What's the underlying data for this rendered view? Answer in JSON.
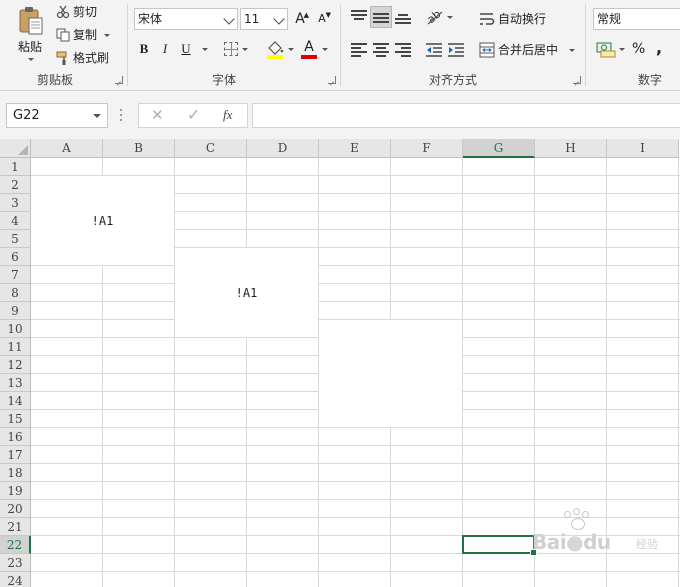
{
  "ribbon": {
    "clipboard": {
      "paste_label": "粘贴",
      "cut_label": "剪切",
      "copy_label": "复制",
      "format_painter_label": "格式刷",
      "group_label": "剪贴板"
    },
    "font": {
      "font_name": "宋体",
      "font_size": "11",
      "bold_label": "B",
      "italic_label": "I",
      "underline_label": "U",
      "increase_label": "A",
      "decrease_label": "A",
      "font_color_label": "A",
      "group_label": "字体",
      "fill_color": "#ffff00",
      "font_color": "#e00000"
    },
    "alignment": {
      "wrap_text_label": "自动换行",
      "merge_center_label": "合并后居中",
      "group_label": "对齐方式"
    },
    "number": {
      "format_value": "常规",
      "percent_label": "%",
      "comma_label": ",",
      "group_label": "数字"
    }
  },
  "formula_bar": {
    "name_box_value": "G22",
    "cancel_icon": "✕",
    "enter_icon": "✓",
    "fx_label": "fx",
    "formula_value": ""
  },
  "sheet": {
    "columns": [
      "A",
      "B",
      "C",
      "D",
      "E",
      "F",
      "G",
      "H",
      "I"
    ],
    "rows": [
      "1",
      "2",
      "3",
      "4",
      "5",
      "6",
      "7",
      "8",
      "9",
      "10",
      "11",
      "12",
      "13",
      "14",
      "15",
      "16",
      "17",
      "18",
      "19",
      "20",
      "21",
      "22",
      "23",
      "24"
    ],
    "selected_column": "G",
    "selected_row": "22",
    "active_cell": "G22",
    "merged_cells": [
      {
        "range": "A2:B6",
        "text": "!A1"
      },
      {
        "range": "C6:D10",
        "text": "!A1"
      },
      {
        "range": "E10:F15",
        "text": ""
      }
    ],
    "accent_color": "#217346"
  },
  "watermark": {
    "text": "Bai",
    "text2": "du",
    "sub": "经验"
  }
}
